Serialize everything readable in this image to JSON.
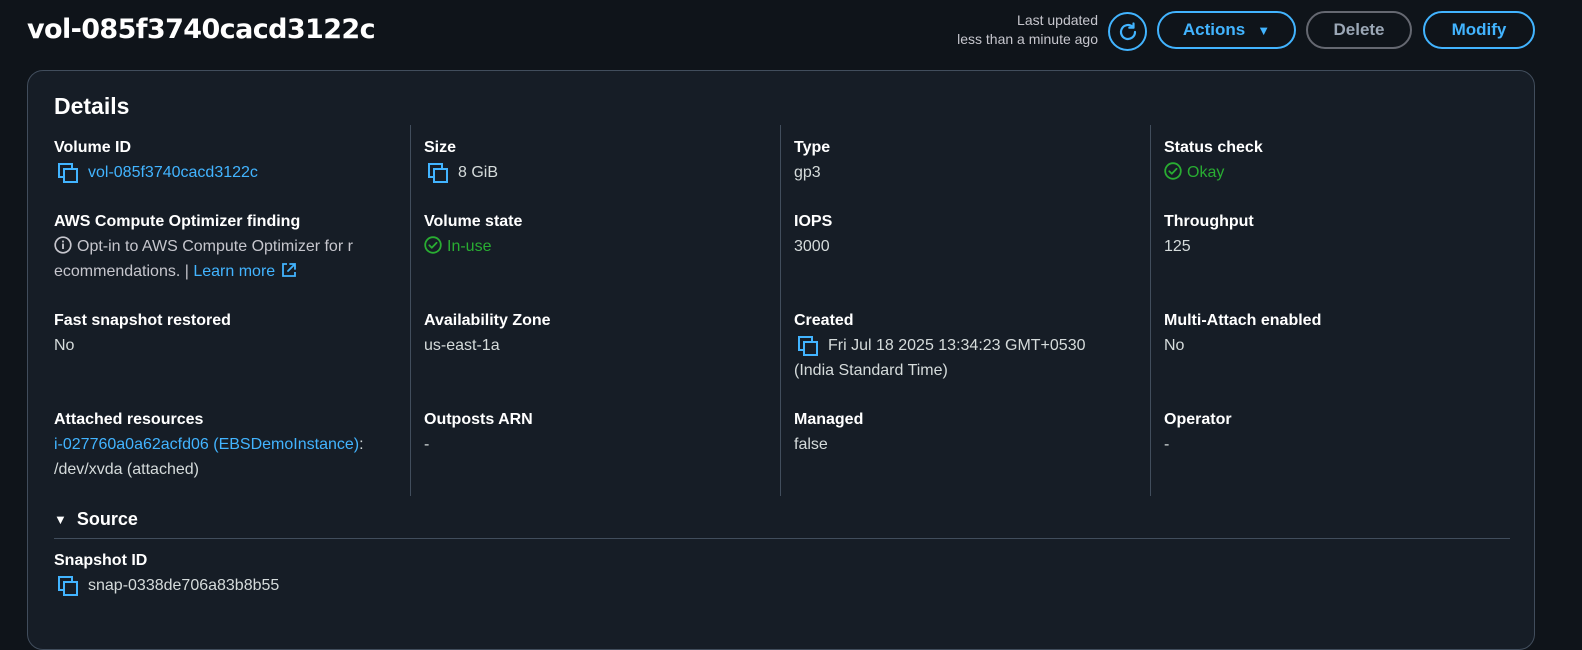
{
  "header": {
    "title": "vol-085f3740cacd3122c",
    "last_updated_label": "Last updated",
    "last_updated_value": "less than a minute ago",
    "actions_label": "Actions",
    "delete_label": "Delete",
    "modify_label": "Modify"
  },
  "details": {
    "title": "Details",
    "volume_id": {
      "label": "Volume ID",
      "value": "vol-085f3740cacd3122c"
    },
    "size": {
      "label": "Size",
      "value": "8 GiB"
    },
    "type": {
      "label": "Type",
      "value": "gp3"
    },
    "status_check": {
      "label": "Status check",
      "value": "Okay"
    },
    "optimizer": {
      "label": "AWS Compute Optimizer finding",
      "line1": "Opt-in to AWS Compute Optimizer for r",
      "line2": "ecommendations. |",
      "learn_more": "Learn more"
    },
    "volume_state": {
      "label": "Volume state",
      "value": "In-use"
    },
    "iops": {
      "label": "IOPS",
      "value": "3000"
    },
    "throughput": {
      "label": "Throughput",
      "value": "125"
    },
    "fast_snapshot": {
      "label": "Fast snapshot restored",
      "value": "No"
    },
    "availability_zone": {
      "label": "Availability Zone",
      "value": "us-east-1a"
    },
    "created": {
      "label": "Created",
      "line1": "Fri Jul 18 2025 13:34:23 GMT+0530",
      "line2": "(India Standard Time)"
    },
    "multi_attach": {
      "label": "Multi-Attach enabled",
      "value": "No"
    },
    "attached": {
      "label": "Attached resources",
      "link": "i-027760a0a62acfd06 (EBSDemoInstance)",
      "suffix": ":",
      "line2": "/dev/xvda (attached)"
    },
    "outposts_arn": {
      "label": "Outposts ARN",
      "value": "-"
    },
    "managed": {
      "label": "Managed",
      "value": "false"
    },
    "operator": {
      "label": "Operator",
      "value": "-"
    }
  },
  "source": {
    "title": "Source",
    "snapshot_id": {
      "label": "Snapshot ID",
      "value": "snap-0338de706a83b8b55"
    }
  },
  "colors": {
    "accent": "#42b4ff",
    "success": "#29ad32",
    "background": "#0f141a",
    "panel": "#161d26",
    "border": "#414d5c"
  },
  "icons": [
    "refresh-icon",
    "caret-down-icon",
    "copy-icon",
    "status-positive-icon",
    "info-icon",
    "external-link-icon",
    "triangle-down-icon"
  ]
}
